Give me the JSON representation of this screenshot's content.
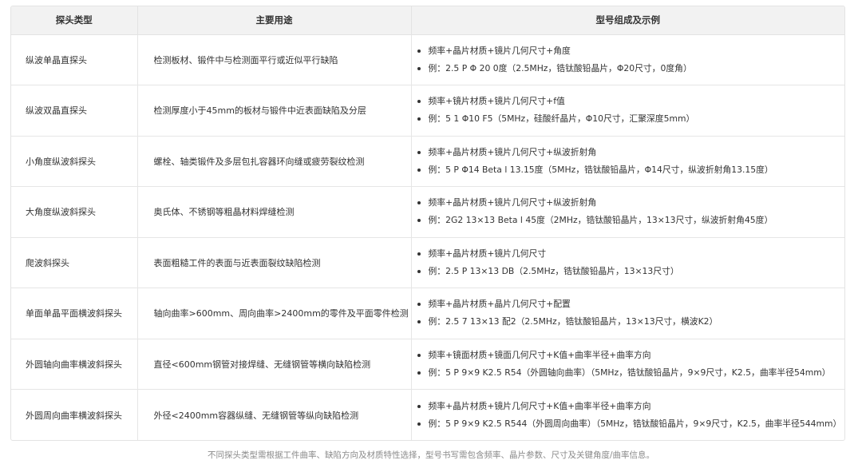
{
  "table": {
    "headers": [
      "探头类型",
      "主要用途",
      "型号组成及示例"
    ],
    "rows": [
      {
        "type": "纵波单晶直探头",
        "use": "检测板材、锻件中与检测面平行或近似平行缺陷",
        "composition": "频率+晶片材质+镜片几何尺寸+角度",
        "example": "例：2.5 P Φ 20 0度（2.5MHz，锆钛酸铅晶片，Φ20尺寸，0度角）"
      },
      {
        "type": "纵波双晶直探头",
        "use": "检测厚度小于45mm的板材与锻件中近表面缺陷及分层",
        "composition": "频率+镜片材质+镜片几何尺寸+f值",
        "example": "例：5 1 Φ10 F5（5MHz，硅酸纤晶片，Φ10尺寸，汇聚深度5mm）"
      },
      {
        "type": "小角度纵波斜探头",
        "use": "螺栓、轴类锻件及多层包扎容器环向缝或疲劳裂纹检测",
        "composition": "频率+晶片材质+镜片几何尺寸+纵波折射角",
        "example": "例：5 P Φ14 Beta l 13.15度（5MHz，锆钛酸铅晶片，Φ14尺寸，纵波折射角13.15度）"
      },
      {
        "type": "大角度纵波斜探头",
        "use": "奥氏体、不锈钢等粗晶材料焊缝检测",
        "composition": "频率+晶片材质+镜片几何尺寸+纵波折射角",
        "example": "例：2G2 13×13 Beta l 45度（2MHz，锆钛酸铅晶片，13×13尺寸，纵波折射角45度）"
      },
      {
        "type": "爬波斜探头",
        "use": "表面粗糙工件的表面与近表面裂纹缺陷检测",
        "composition": "频率+晶片材质+镜片几何尺寸",
        "example": "例：2.5 P 13×13 DB（2.5MHz，锆钛酸铅晶片，13×13尺寸）"
      },
      {
        "type": "单面单晶平面横波斜探头",
        "use": "轴向曲率>600mm、周向曲率>2400mm的零件及平面零件检测",
        "composition": "频率+晶片材质+晶片几何尺寸+配置",
        "example": "例：2.5 7 13×13 配2（2.5MHz，锆钛酸铅晶片，13×13尺寸，横波K2）"
      },
      {
        "type": "外圆轴向曲率横波斜探头",
        "use": "直径<600mm钢管对接焊缝、无缝钢管等横向缺陷检测",
        "composition": "频率+镜面材质+镜面几何尺寸+K值+曲率半径+曲率方向",
        "example": "例：5 P 9×9 K2.5 R54（外圆轴向曲率）（5MHz，锆钛酸铅晶片，9×9尺寸，K2.5，曲率半径54mm）"
      },
      {
        "type": "外圆周向曲率横波斜探头",
        "use": "外径<2400mm容器纵缝、无缝钢管等纵向缺陷检测",
        "composition": "频率+晶片材质+镜片几何尺寸+K值+曲率半径+曲率方向",
        "example": "例：5 P 9×9 K2.5 R544（外圆周向曲率）（5MHz，锆钛酸铅晶片，9×9尺寸，K2.5，曲率半径544mm）"
      }
    ]
  },
  "footnote": "不同探头类型需根据工件曲率、缺陷方向及材质特性选择，型号书写需包含频率、晶片参数、尺寸及关键角度/曲率信息。"
}
